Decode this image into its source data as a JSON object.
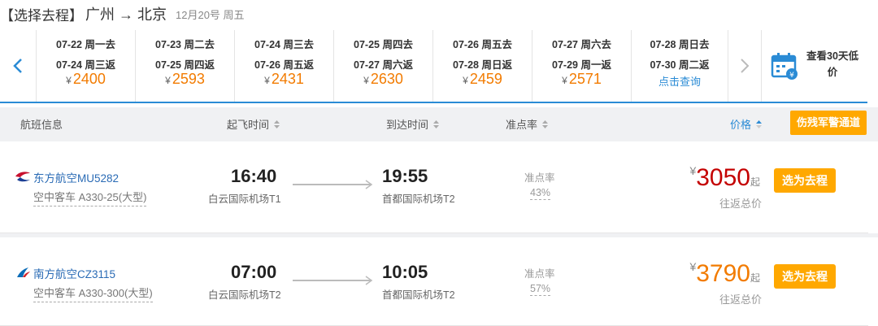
{
  "header": {
    "bracket_title": "【选择去程】",
    "route": "广州 → 北京",
    "date": "12月20号 周五"
  },
  "dates": [
    {
      "out": "07-22 周一去",
      "ret": "07-24 周三返",
      "price": "2400"
    },
    {
      "out": "07-23 周二去",
      "ret": "07-25 周四返",
      "price": "2593"
    },
    {
      "out": "07-24 周三去",
      "ret": "07-26 周五返",
      "price": "2431"
    },
    {
      "out": "07-25 周四去",
      "ret": "07-27 周六返",
      "price": "2630"
    },
    {
      "out": "07-26 周五去",
      "ret": "07-28 周日返",
      "price": "2459"
    },
    {
      "out": "07-27 周六去",
      "ret": "07-29 周一返",
      "price": "2571"
    },
    {
      "out": "07-28 周日去",
      "ret": "07-30 周二返",
      "query": "点击查询"
    }
  ],
  "currency": "¥",
  "calendar": {
    "label": "查看30天低价"
  },
  "columns": {
    "flight_info": "航班信息",
    "depart": "起飞时间",
    "arrive": "到达时间",
    "punctuality": "准点率",
    "price": "价格"
  },
  "police_channel": "伤残军警通道",
  "flights": [
    {
      "airline": "东方航空MU5282",
      "aircraft": "空中客车 A330-25(大型)",
      "dep_time": "16:40",
      "dep_airport": "白云国际机场T1",
      "arr_time": "19:55",
      "arr_airport": "首都国际机场T2",
      "punct_label": "准点率",
      "punct": "43%",
      "price": "3050",
      "price_suffix": "起",
      "price_color": "#c40000",
      "price_note": "往返总价",
      "select": "选为去程",
      "logo_icon": "china-eastern-logo-icon"
    },
    {
      "airline": "南方航空CZ3115",
      "aircraft": "空中客车 A330-300(大型)",
      "dep_time": "07:00",
      "dep_airport": "白云国际机场T2",
      "arr_time": "10:05",
      "arr_airport": "首都国际机场T2",
      "punct_label": "准点率",
      "punct": "57%",
      "price": "3790",
      "price_suffix": "起",
      "price_color": "#f27b00",
      "price_note": "往返总价",
      "select": "选为去程",
      "logo_icon": "china-southern-logo-icon"
    }
  ]
}
